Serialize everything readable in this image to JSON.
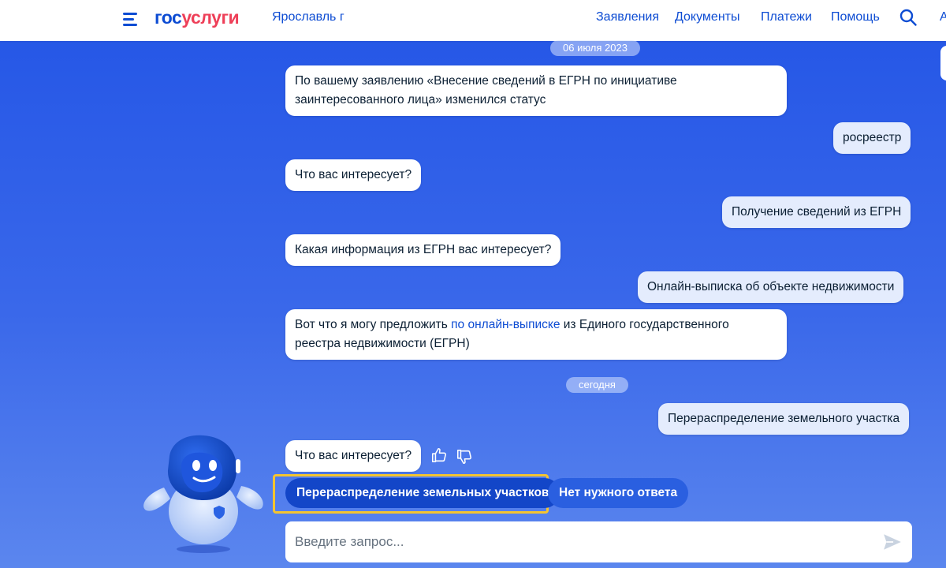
{
  "header": {
    "logo_part1": "гос",
    "logo_part2": "услуги",
    "city": "Ярославль г",
    "nav": [
      "Заявления",
      "Документы",
      "Платежи",
      "Помощь"
    ],
    "cut_letter": "А",
    "icons": [
      "menu-icon",
      "search-icon"
    ]
  },
  "chat": {
    "date1": "06 июля 2023",
    "messages": [
      {
        "from": "bot",
        "text": "По вашему заявлению «Внесение сведений в ЕГРН по инициативе заинтересованного лица» изменился статус"
      },
      {
        "from": "user",
        "text": "росреестр"
      },
      {
        "from": "bot",
        "text": "Что вас интересует?"
      },
      {
        "from": "user",
        "text": "Получение сведений из ЕГРН"
      },
      {
        "from": "bot",
        "text": "Какая информация из ЕГРН вас интересует?"
      },
      {
        "from": "user",
        "text": "Онлайн-выписка об объекте недвижимости"
      },
      {
        "from": "bot",
        "text_before": "Вот что я могу предложить ",
        "link": "по онлайн-выписке",
        "text_after": " из Единого государственного реестра недвижимости (ЕГРН)"
      }
    ],
    "date2": "сегодня",
    "messages_today": [
      {
        "from": "user",
        "text": "Перераспределение земельного участка"
      },
      {
        "from": "bot",
        "text": "Что вас интересует?"
      }
    ],
    "feedback_icons": [
      "thumbs-up-icon",
      "thumbs-down-icon"
    ],
    "quick_replies": [
      "Перераспределение земельных участков",
      "Нет нужного ответа"
    ]
  },
  "composer": {
    "placeholder": "Введите запрос...",
    "send_icon": "send-icon"
  },
  "colors": {
    "brand_blue": "#0d4cd3",
    "brand_red": "#ee3f58",
    "highlight": "#f4c430"
  }
}
